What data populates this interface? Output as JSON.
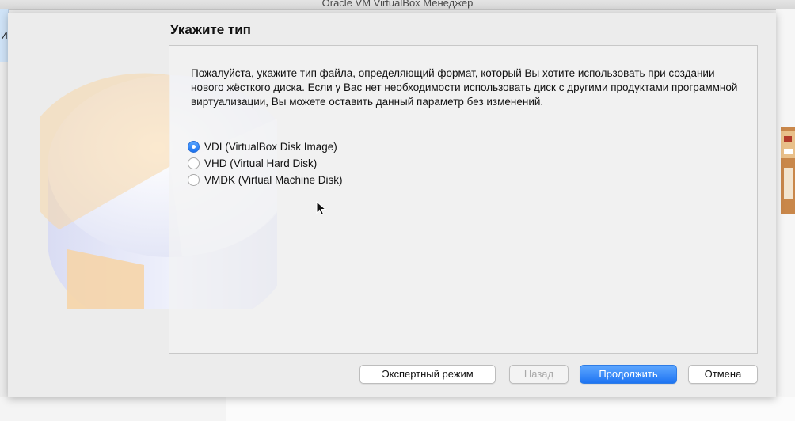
{
  "window": {
    "title": "Oracle VM VirtualBox Менеджер"
  },
  "background": {
    "left_strip_text": "Им"
  },
  "wizard": {
    "title": "Укажите тип",
    "description": "Пожалуйста, укажите тип файла, определяющий формат, который Вы хотите использовать при создании нового жёсткого диска. Если у Вас нет необходимости использовать диск с другими продуктами программной виртуализации, Вы можете оставить данный параметр без изменений.",
    "options": [
      {
        "label": "VDI (VirtualBox Disk Image)",
        "selected": true
      },
      {
        "label": "VHD (Virtual Hard Disk)",
        "selected": false
      },
      {
        "label": "VMDK (Virtual Machine Disk)",
        "selected": false
      }
    ],
    "buttons": {
      "expert": "Экспертный режим",
      "back": "Назад",
      "next": "Продолжить",
      "cancel": "Отмена"
    },
    "icons": {
      "disk_art": "hard-disk-pie-icon",
      "cursor": "mouse-pointer-icon"
    },
    "colors": {
      "accent": "#1e74f2",
      "disk_wedge": "#f8cf98"
    }
  }
}
